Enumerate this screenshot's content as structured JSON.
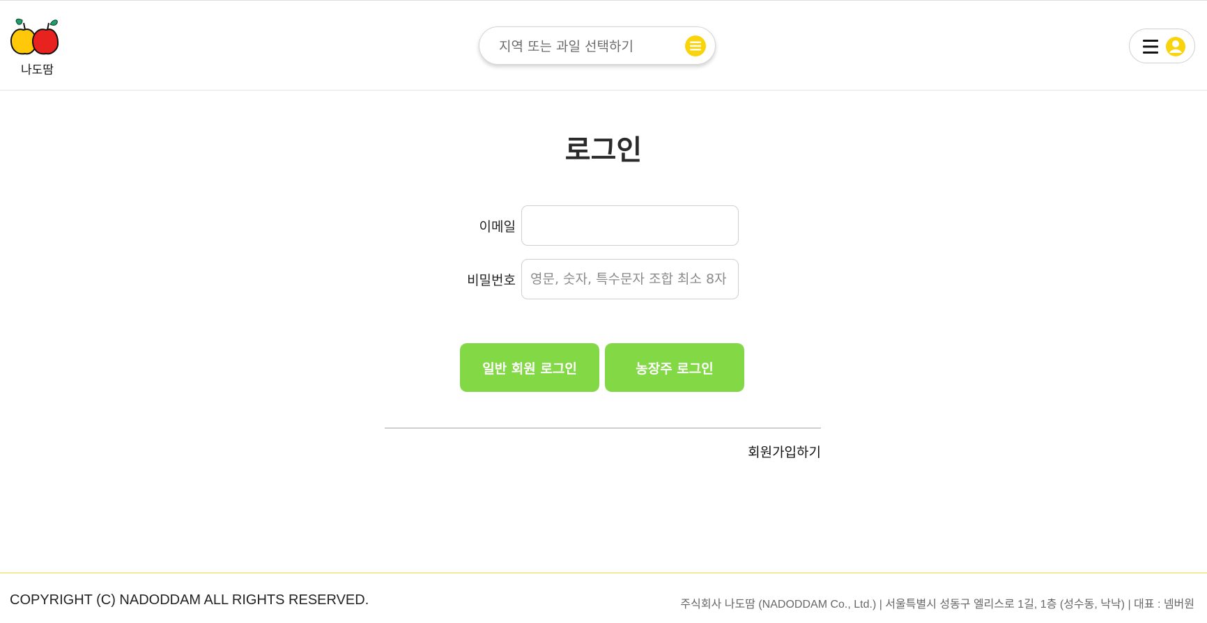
{
  "header": {
    "logo_text": "나도땀",
    "search": {
      "placeholder": "지역 또는 과일 선택하기",
      "value": ""
    },
    "icons": {
      "search_menu": "menu-lines-icon",
      "hamburger": "hamburger-icon",
      "user": "user-circle-icon"
    }
  },
  "login": {
    "title": "로그인",
    "email": {
      "label": "이메일",
      "value": "",
      "placeholder": ""
    },
    "password": {
      "label": "비밀번호",
      "value": "",
      "placeholder": "영문, 숫자, 특수문자 조합 최소 8자"
    },
    "buttons": {
      "member_login": "일반 회원 로그인",
      "farmer_login": "농장주 로그인"
    },
    "signup_link": "회원가입하기"
  },
  "footer": {
    "copyright": "COPYRIGHT (C) NADODDAM ALL RIGHTS RESERVED.",
    "company_info": "주식회사 나도땀 (NADODDAM Co., Ltd.) | 서울특별시 성동구 엘리스로 1길, 1층 (성수동, 낙낙) | 대표 : 넴버원"
  },
  "colors": {
    "accent_yellow": "#f9d30c",
    "button_green": "#82d845",
    "footer_border": "#f5ec9a",
    "logo_red": "#e8231f",
    "logo_yellow": "#ffc90a"
  }
}
